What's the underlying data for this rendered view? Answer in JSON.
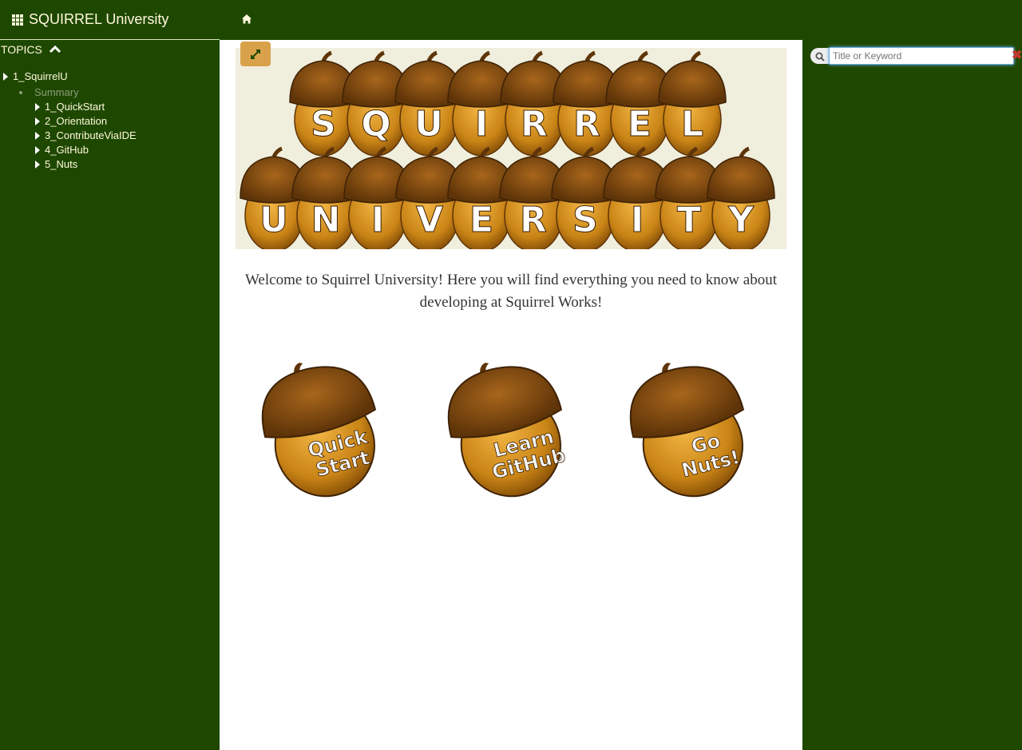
{
  "header": {
    "brand": "SQUIRREL University"
  },
  "sidebar": {
    "topics_label": "TOPICS",
    "root": "1_SquirrelU",
    "summary": "Summary",
    "children": [
      "1_QuickStart",
      "2_Orientation",
      "3_ContributeViaIDE",
      "4_GitHub",
      "5_Nuts"
    ]
  },
  "banner": {
    "line1": "SQUIRREL",
    "line2": "UNIVERSITY"
  },
  "main": {
    "welcome": "Welcome to Squirrel University! Here you will find everything you need to know about developing at Squirrel Works!",
    "nuts": [
      {
        "line1": "Quick",
        "line2": "Start"
      },
      {
        "line1": "Learn",
        "line2": "GitHub"
      },
      {
        "line1": "Go",
        "line2": "Nuts!"
      }
    ]
  },
  "search": {
    "placeholder": "Title or Keyword"
  },
  "colors": {
    "theme": "#1e4800",
    "acorn": "#c98416",
    "cap": "#7a4a12",
    "button": "#d9a24a"
  }
}
